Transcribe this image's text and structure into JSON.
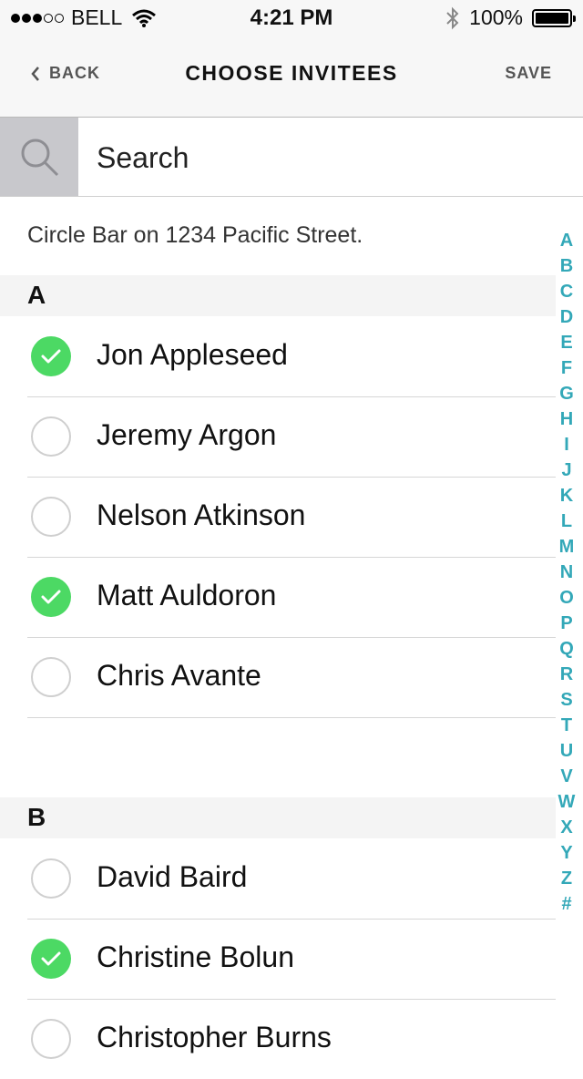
{
  "status_bar": {
    "signal_strength": "3 of 5",
    "carrier": "BELL",
    "time": "4:21 PM",
    "battery": "100%",
    "icons": [
      "wifi-icon",
      "bluetooth-icon",
      "battery-icon"
    ]
  },
  "nav": {
    "back_label": "BACK",
    "title": "CHOOSE INVITEES",
    "save_label": "SAVE"
  },
  "search": {
    "placeholder": "Search"
  },
  "location_text": "Circle Bar on 1234 Pacific Street.",
  "sections": [
    {
      "letter": "A",
      "contacts": [
        {
          "name": "Jon Appleseed",
          "selected": true
        },
        {
          "name": "Jeremy Argon",
          "selected": false
        },
        {
          "name": "Nelson Atkinson",
          "selected": false
        },
        {
          "name": "Matt Auldoron",
          "selected": true
        },
        {
          "name": "Chris Avante",
          "selected": false
        }
      ]
    },
    {
      "letter": "B",
      "contacts": [
        {
          "name": "David Baird",
          "selected": false
        },
        {
          "name": "Christine Bolun",
          "selected": true
        },
        {
          "name": "Christopher Burns",
          "selected": false
        }
      ]
    }
  ],
  "index_letters": [
    "A",
    "B",
    "C",
    "D",
    "E",
    "F",
    "G",
    "H",
    "I",
    "J",
    "K",
    "L",
    "M",
    "N",
    "O",
    "P",
    "Q",
    "R",
    "S",
    "T",
    "U",
    "V",
    "W",
    "X",
    "Y",
    "Z",
    "#"
  ],
  "colors": {
    "accent": "#33a8b8",
    "selected": "#4cd964",
    "bar_background": "#f7f7f7",
    "search_icon_background": "#c8c8cc"
  }
}
